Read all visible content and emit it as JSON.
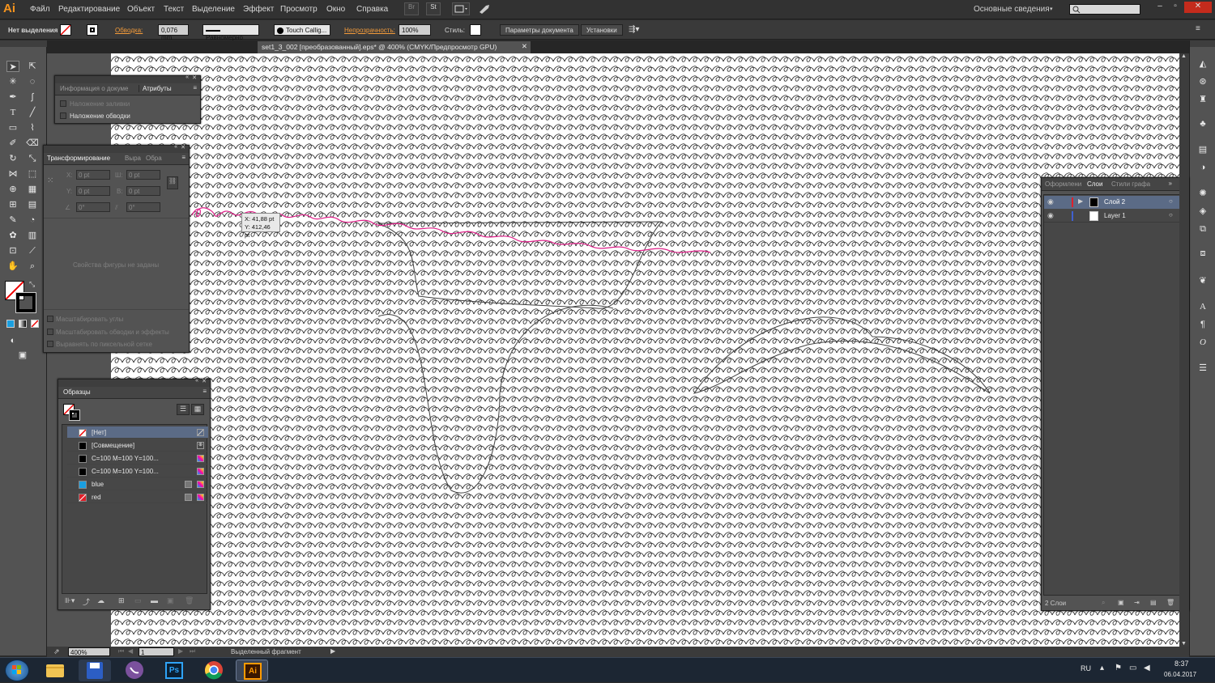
{
  "app": {
    "logo": "Ai"
  },
  "menu": [
    "Файл",
    "Редактирование",
    "Объект",
    "Текст",
    "Выделение",
    "Эффект",
    "Просмотр",
    "Окно",
    "Справка"
  ],
  "menu_icons": [
    "br-icon",
    "st-icon",
    "arrange-docs-icon",
    "sync-icon"
  ],
  "menu_icon_labels": {
    "br": "Br",
    "st": "St"
  },
  "workspace": "Основные сведения",
  "search": {
    "placeholder": ""
  },
  "control": {
    "selection": "Нет выделения",
    "stroke_label": "Обводка:",
    "stroke_weight": "0,076 mm",
    "profile": "Равномерно",
    "brush": "Touch Callig...",
    "opacity_label": "Непрозрачность:",
    "opacity": "100%",
    "style_label": "Стиль:",
    "doc_setup": "Параметры документа",
    "prefs": "Установки"
  },
  "document": {
    "tab": "set1_3_002 [преобразованный].eps* @ 400% (CMYK/Предпросмотр GPU)"
  },
  "tooltip": {
    "x": "X: 41,88 pt",
    "y": "Y: 412,46 pt"
  },
  "attributes_panel": {
    "tabs": [
      "Информация о докуме",
      "Атрибуты"
    ],
    "overprint_fill": "Наложение заливки",
    "overprint_stroke": "Наложение обводки"
  },
  "transform_panel": {
    "tabs": [
      "Трансформирование",
      "Выра",
      "Обра"
    ],
    "x_label": "X:",
    "x": "0 pt",
    "w_label": "Ш:",
    "w": "0 pt",
    "y_label": "Y:",
    "y": "0 pt",
    "h_label": "В:",
    "h": "0 pt",
    "rot": "0°",
    "shear": "0°",
    "no_shape": "Свойства фигуры не заданы",
    "scale_corners": "Масштабировать углы",
    "scale_strokes": "Масштабировать обводки и эффекты",
    "pixel_align": "Выравнять по пиксельной сетке"
  },
  "swatches_panel": {
    "tab": "Образцы",
    "items": [
      {
        "name": "[Нет]",
        "color": "#ffffff"
      },
      {
        "name": "[Совмещение]",
        "color": "#000000"
      },
      {
        "name": "C=100 M=100 Y=100...",
        "color": "#000000"
      },
      {
        "name": "C=100 M=100 Y=100...",
        "color": "#000000"
      },
      {
        "name": "blue",
        "color": "#1a9fe0"
      },
      {
        "name": "red",
        "color": "#e0202a"
      }
    ]
  },
  "layers_panel": {
    "tabs": [
      "Оформлени",
      "Слои",
      "Стили графа"
    ],
    "layers": [
      {
        "name": "Слой 2",
        "color": "#e0202a"
      },
      {
        "name": "Layer 1",
        "color": "#4060d0"
      }
    ],
    "count": "2 Слои"
  },
  "status": {
    "zoom": "400%",
    "page": "1",
    "mode": "Выделенный фрагмент"
  },
  "taskbar": {
    "lang": "RU",
    "time": "8:37",
    "date": "06.04.2017",
    "ps_label": "Ps",
    "ai_label": "Ai"
  },
  "colors": {
    "accent": "#f39b3a",
    "ai_orange": "#f7941d",
    "panel": "#535353"
  }
}
